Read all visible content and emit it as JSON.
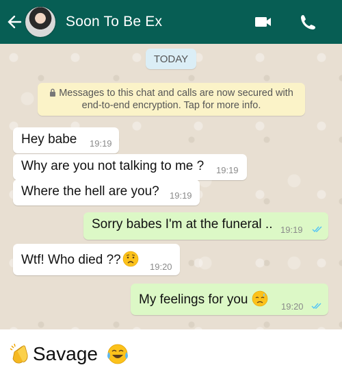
{
  "header": {
    "contact_name": "Soon To Be Ex",
    "back_icon": "arrow-left-icon",
    "video_icon": "video-camera-icon",
    "call_icon": "phone-icon",
    "color": "#075e54"
  },
  "chat": {
    "date_label": "TODAY",
    "encryption_notice_line1": "Messages to this chat and calls are now secured with",
    "encryption_notice_line2": "end-to-end encryption. Tap for more info.",
    "messages": [
      {
        "direction": "incoming",
        "text": "Hey babe",
        "time": "19:19"
      },
      {
        "direction": "incoming",
        "text": "Why are you not talking to me ?",
        "time": "19:19"
      },
      {
        "direction": "incoming",
        "text": "Where the hell are you?",
        "time": "19:19"
      },
      {
        "direction": "outgoing",
        "text": "Sorry babes I'm at the funeral ..",
        "time": "19:19",
        "status": "read"
      },
      {
        "direction": "incoming",
        "text": "Wtf! Who died ??",
        "emoji": "worried-face-icon",
        "time": "19:20"
      },
      {
        "direction": "outgoing",
        "text": "My feelings for you",
        "emoji": "sad-relieved-face-icon",
        "time": "19:20",
        "status": "read"
      }
    ],
    "colors": {
      "incoming": "#ffffff",
      "outgoing": "#dcf8c6",
      "read_ticks": "#4fc3f7",
      "background": "#e8dfd2"
    }
  },
  "caption": {
    "text": "Savage",
    "leading_emoji": "clapping-hands-icon",
    "trailing_emoji": "tears-of-joy-icon"
  }
}
